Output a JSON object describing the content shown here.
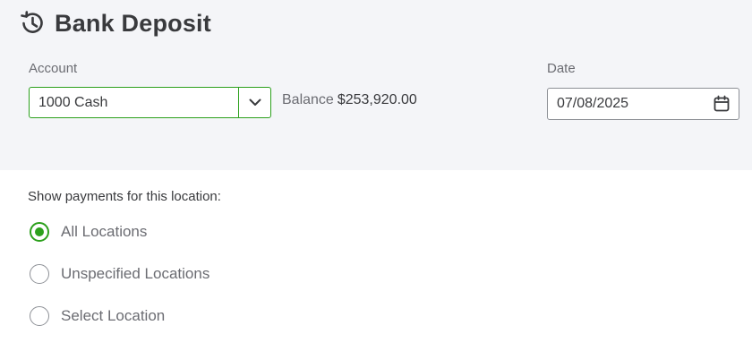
{
  "header": {
    "title": "Bank Deposit",
    "icon": "history-icon"
  },
  "account": {
    "label": "Account",
    "value": "1000 Cash",
    "balance_label": "Balance",
    "balance_amount": "$253,920.00"
  },
  "date": {
    "label": "Date",
    "value": "07/08/2025"
  },
  "locations": {
    "heading": "Show payments for this location:",
    "options": [
      {
        "label": "All Locations",
        "checked": true
      },
      {
        "label": "Unspecified Locations",
        "checked": false
      },
      {
        "label": "Select Location",
        "checked": false
      }
    ]
  },
  "colors": {
    "accent": "#2ca01c",
    "panel_bg": "#f4f5f8",
    "text": "#393a3d",
    "muted": "#6b6c72"
  }
}
